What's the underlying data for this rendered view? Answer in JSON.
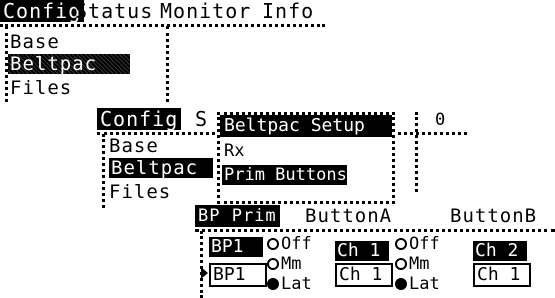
{
  "screen1": {
    "tabs": [
      "Config",
      "Status",
      "Monitor",
      "Info"
    ],
    "menu": [
      "Base",
      "Beltpac",
      "Files"
    ]
  },
  "screen2": {
    "tabs": [
      "Config",
      "S"
    ],
    "menu": [
      "Base",
      "Beltpac",
      "Files"
    ],
    "popup": {
      "title": "Beltpac Setup",
      "items": [
        "Rx",
        "Prim Buttons"
      ]
    },
    "value": "0"
  },
  "screen3": {
    "tab_selected": "BP Prim",
    "col_a": "ButtonA",
    "col_b": "ButtonB",
    "bp_top": "BP1",
    "bp_bottom": "BP1",
    "radios_a": [
      "Off",
      "Mm",
      "Lat"
    ],
    "radios_b": [
      "Off",
      "Mm",
      "Lat"
    ],
    "ch_a_top": "Ch 1",
    "ch_a_bottom": "Ch 1",
    "ch_b_top": "Ch 2",
    "ch_b_bottom": "Ch 1"
  }
}
